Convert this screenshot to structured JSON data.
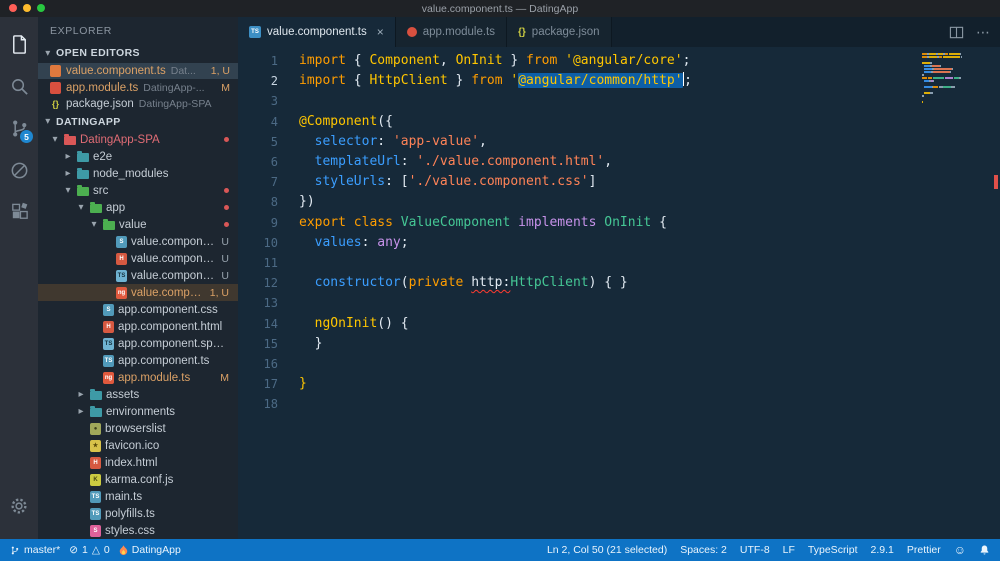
{
  "window": {
    "title": "value.component.ts — DatingApp"
  },
  "colors": {
    "status_bar": "#0e73c5",
    "editor_bg": "#162939",
    "error": "#e0504a",
    "git_modified": "#dba166",
    "selection": "#0d5fa7",
    "badge": "#1f87d0"
  },
  "icons": {
    "chevron_down": "▾",
    "chevron_right": "▸",
    "close": "×",
    "more": "⋯",
    "error_glyph": "⊘",
    "warning_glyph": "△",
    "smiley": "☺",
    "ts_glyph": "TS",
    "json_glyph": "{}"
  },
  "glyphs": {
    "file-css": "S",
    "file-css-pink": "S",
    "file-html": "H",
    "file-spec": "TS",
    "file-ts": "TS",
    "file-ng": "ng",
    "file-karma": "K",
    "file-favicon": "★",
    "file-browserslist": "●",
    "file-json": "{}"
  },
  "activity_bar": {
    "badge": "5"
  },
  "explorer": {
    "title": "EXPLORER",
    "open_editors": {
      "header": "OPEN EDITORS",
      "items": [
        {
          "label": "value.component.ts",
          "detail": "Dat...",
          "badge": "1, U"
        },
        {
          "label": "app.module.ts",
          "detail": "DatingApp-...",
          "badge": "M"
        },
        {
          "label": "package.json",
          "detail": "DatingApp-SPA",
          "badge": ""
        }
      ]
    },
    "section": {
      "header": "DATINGAPP",
      "tree": [
        {
          "label": "DatingApp-SPA",
          "depth": 0,
          "kind": "folder",
          "expanded": true,
          "icon": "folder-red",
          "cls": "red-label",
          "dot": true
        },
        {
          "label": "e2e",
          "depth": 1,
          "kind": "folder",
          "expanded": false,
          "icon": "folder-teal"
        },
        {
          "label": "node_modules",
          "depth": 1,
          "kind": "folder",
          "expanded": false,
          "icon": "folder-teal"
        },
        {
          "label": "src",
          "depth": 1,
          "kind": "folder",
          "expanded": true,
          "icon": "folder-green",
          "dot": true
        },
        {
          "label": "app",
          "depth": 2,
          "kind": "folder",
          "expanded": true,
          "icon": "folder-green",
          "dot": true
        },
        {
          "label": "value",
          "depth": 3,
          "kind": "folder",
          "expanded": true,
          "icon": "folder-green",
          "dot": true
        },
        {
          "label": "value.component....",
          "depth": 4,
          "kind": "file",
          "icon": "file-css",
          "badge": "U"
        },
        {
          "label": "value.component....",
          "depth": 4,
          "kind": "file",
          "icon": "file-html",
          "badge": "U"
        },
        {
          "label": "value.component....",
          "depth": 4,
          "kind": "file",
          "icon": "file-spec",
          "badge": "U"
        },
        {
          "label": "value.componen...",
          "depth": 4,
          "kind": "file",
          "icon": "file-ng",
          "badge": "1, U",
          "cls": "mod-label",
          "selected": true
        },
        {
          "label": "app.component.css",
          "depth": 3,
          "kind": "file",
          "icon": "file-css"
        },
        {
          "label": "app.component.html",
          "depth": 3,
          "kind": "file",
          "icon": "file-html"
        },
        {
          "label": "app.component.spec.ts",
          "depth": 3,
          "kind": "file",
          "icon": "file-spec"
        },
        {
          "label": "app.component.ts",
          "depth": 3,
          "kind": "file",
          "icon": "file-ts"
        },
        {
          "label": "app.module.ts",
          "depth": 3,
          "kind": "file",
          "icon": "file-ng",
          "badge": "M",
          "cls": "mod-label"
        },
        {
          "label": "assets",
          "depth": 2,
          "kind": "folder",
          "expanded": false,
          "icon": "folder-teal"
        },
        {
          "label": "environments",
          "depth": 2,
          "kind": "folder",
          "expanded": false,
          "icon": "folder-teal"
        },
        {
          "label": "browserslist",
          "depth": 2,
          "kind": "file",
          "icon": "file-browserslist"
        },
        {
          "label": "favicon.ico",
          "depth": 2,
          "kind": "file",
          "icon": "file-favicon"
        },
        {
          "label": "index.html",
          "depth": 2,
          "kind": "file",
          "icon": "file-html"
        },
        {
          "label": "karma.conf.js",
          "depth": 2,
          "kind": "file",
          "icon": "file-karma"
        },
        {
          "label": "main.ts",
          "depth": 2,
          "kind": "file",
          "icon": "file-ts"
        },
        {
          "label": "polyfills.ts",
          "depth": 2,
          "kind": "file",
          "icon": "file-ts"
        },
        {
          "label": "styles.css",
          "depth": 2,
          "kind": "file",
          "icon": "file-css-pink"
        }
      ]
    }
  },
  "tabs": {
    "items": [
      {
        "label": "value.component.ts"
      },
      {
        "label": "app.module.ts"
      },
      {
        "label": "package.json"
      }
    ]
  },
  "editor": {
    "lines": [
      {
        "n": "1",
        "t": [
          [
            "kw",
            "import"
          ],
          [
            "pl",
            " { "
          ],
          [
            "ent",
            "Component"
          ],
          [
            "pl",
            ", "
          ],
          [
            "ent",
            "OnInit"
          ],
          [
            "pl",
            " } "
          ],
          [
            "kw",
            "from"
          ],
          [
            "pl",
            " "
          ],
          [
            "str",
            "'@angular/core'"
          ],
          [
            "pl",
            ";"
          ]
        ]
      },
      {
        "n": "2",
        "active": true,
        "t": [
          [
            "kw",
            "import"
          ],
          [
            "pl",
            " { "
          ],
          [
            "ent",
            "HttpClient"
          ],
          [
            "pl",
            " } "
          ],
          [
            "kw",
            "from"
          ],
          [
            "pl",
            " "
          ],
          [
            "str",
            "'"
          ],
          [
            "str sel",
            "@angular/common/http'"
          ],
          [
            "cursor",
            ""
          ],
          [
            "pl",
            ";"
          ]
        ]
      },
      {
        "n": "3",
        "t": []
      },
      {
        "n": "4",
        "t": [
          [
            "ent",
            "@Component"
          ],
          [
            "pl",
            "({"
          ]
        ]
      },
      {
        "n": "5",
        "t": [
          [
            "pl",
            "  "
          ],
          [
            "prop",
            "selector"
          ],
          [
            "pl",
            ": "
          ],
          [
            "str2",
            "'app-value'"
          ],
          [
            "pl",
            ","
          ]
        ]
      },
      {
        "n": "6",
        "t": [
          [
            "pl",
            "  "
          ],
          [
            "prop",
            "templateUrl"
          ],
          [
            "pl",
            ": "
          ],
          [
            "str2",
            "'./value.component.html'"
          ],
          [
            "pl",
            ","
          ]
        ]
      },
      {
        "n": "7",
        "t": [
          [
            "pl",
            "  "
          ],
          [
            "prop",
            "styleUrls"
          ],
          [
            "pl",
            ": ["
          ],
          [
            "str2",
            "'./value.component.css'"
          ],
          [
            "pl",
            "]"
          ]
        ]
      },
      {
        "n": "8",
        "t": [
          [
            "pl",
            "})"
          ]
        ]
      },
      {
        "n": "9",
        "t": [
          [
            "kw",
            "export"
          ],
          [
            "pl",
            " "
          ],
          [
            "kw",
            "class"
          ],
          [
            "pl",
            " "
          ],
          [
            "typ",
            "ValueComponent"
          ],
          [
            "pl",
            " "
          ],
          [
            "imp",
            "implements"
          ],
          [
            "pl",
            " "
          ],
          [
            "typ",
            "OnInit"
          ],
          [
            "pl",
            " {"
          ]
        ]
      },
      {
        "n": "10",
        "t": [
          [
            "pl",
            "  "
          ],
          [
            "prop",
            "values"
          ],
          [
            "pl",
            ": "
          ],
          [
            "imp",
            "any"
          ],
          [
            "pl",
            ";"
          ]
        ]
      },
      {
        "n": "11",
        "t": []
      },
      {
        "n": "12",
        "t": [
          [
            "pl",
            "  "
          ],
          [
            "prop",
            "constructor"
          ],
          [
            "pl",
            "("
          ],
          [
            "kw",
            "private"
          ],
          [
            "pl",
            " "
          ],
          [
            "pl sq",
            "http:"
          ],
          [
            "typ",
            "HttpClient"
          ],
          [
            "pl",
            ") { }"
          ]
        ]
      },
      {
        "n": "13",
        "t": []
      },
      {
        "n": "14",
        "t": [
          [
            "pl",
            "  "
          ],
          [
            "ent",
            "ngOnInit"
          ],
          [
            "pl",
            "() {"
          ]
        ]
      },
      {
        "n": "15",
        "t": [
          [
            "pl",
            "  }"
          ]
        ]
      },
      {
        "n": "16",
        "t": []
      },
      {
        "n": "17",
        "t": [
          [
            "ent",
            "}"
          ]
        ]
      },
      {
        "n": "18",
        "t": []
      }
    ]
  },
  "status_bar": {
    "branch": "master*",
    "errors": "1",
    "warnings": "0",
    "project": "DatingApp",
    "right": [
      "Ln 2, Col 50 (21 selected)",
      "Spaces: 2",
      "UTF-8",
      "LF",
      "TypeScript",
      "2.9.1",
      "Prettier"
    ]
  }
}
